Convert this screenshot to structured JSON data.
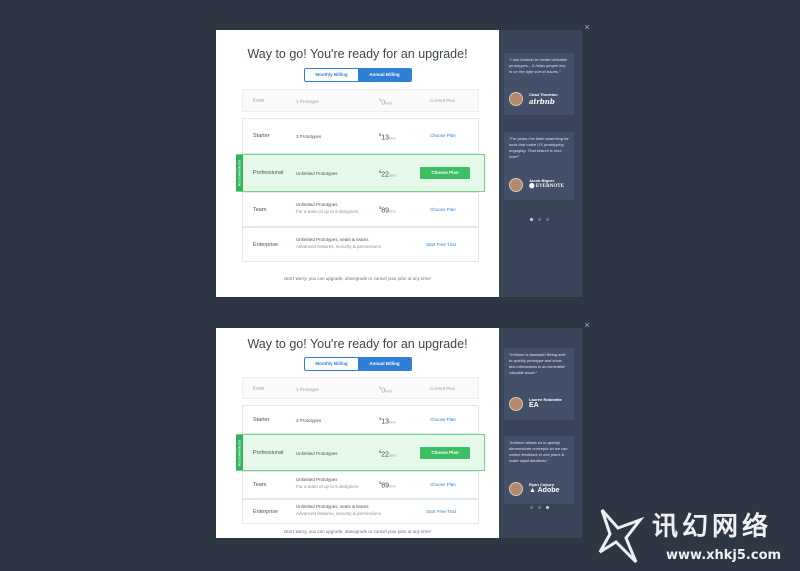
{
  "modals": [
    {
      "title": "Way to go! You're ready for an upgrade!",
      "billing": {
        "monthly": "Monthly Billing",
        "annual": "Annual Billing",
        "selected": "annual"
      },
      "plans": {
        "free": {
          "name": "Free",
          "desc": "1 Prototype",
          "price_symbol": "$",
          "price": "0",
          "per": "/mo",
          "action": "Current Plan"
        },
        "starter": {
          "name": "Starter",
          "desc": "3 Prototypes",
          "price_symbol": "$",
          "price": "13",
          "per": "/mo",
          "action": "Choose Plan"
        },
        "professional": {
          "name": "Professional",
          "desc": "Unlimited Prototypes",
          "price_symbol": "$",
          "price": "22",
          "per": "/mo",
          "action": "Choose Plan",
          "badge": "RECOMMENDED"
        },
        "team": {
          "name": "Team",
          "desc": "Unlimited Prototypes",
          "sub": "For a team of up to 5 designers",
          "price_symbol": "$",
          "price": "89",
          "per": "/mo",
          "action": "Choose Plan"
        },
        "enterprise": {
          "name": "Enterprise",
          "desc": "Unlimited Prototypes, seats & teams",
          "sub": "Advanced features, security & permissions",
          "action": "Start Free Trial"
        }
      },
      "footnote": "Don't worry, you can upgrade, downgrade or cancel your plan at any time!",
      "close": "×",
      "testimonials": [
        {
          "quote": "\"I use Invision to create clickable prototypes... It helps people key in on the right sort of issues.\"",
          "name": "Chad Thornton",
          "brand": "airbnb"
        },
        {
          "quote": "\"For years I've been searching for tools that make UX prototyping engaging. That search is now over!\"",
          "name": "Jacob Bigner",
          "brand": "EVERNOTE"
        }
      ]
    },
    {
      "title": "Way to go! You're ready for an upgrade!",
      "billing": {
        "monthly": "Monthly Billing",
        "annual": "Annual Billing",
        "selected": "annual"
      },
      "plans": {
        "free": {
          "name": "Free",
          "desc": "1 Prototype",
          "price_symbol": "$",
          "price": "0",
          "per": "/mo",
          "action": "Current Plan"
        },
        "starter": {
          "name": "Starter",
          "desc": "3 Prototypes",
          "price_symbol": "$",
          "price": "13",
          "per": "/mo",
          "action": "Choose Plan"
        },
        "professional": {
          "name": "Professional",
          "desc": "Unlimited Prototypes",
          "price_symbol": "$",
          "price": "22",
          "per": "/mo",
          "action": "Choose Plan",
          "badge": "RECOMMENDED"
        },
        "team": {
          "name": "Team",
          "desc": "Unlimited Prototypes",
          "sub": "For a team of up to 5 designers",
          "price_symbol": "$",
          "price": "89",
          "per": "/mo",
          "action": "Choose Plan"
        },
        "enterprise": {
          "name": "Enterprise",
          "desc": "Unlimited Prototypes, seats & teams",
          "sub": "Advanced features, security & permissions",
          "action": "Start Free Trial"
        }
      },
      "footnote": "Don't worry, you can upgrade, downgrade or cancel your plan at any time!",
      "close": "×",
      "testimonials": [
        {
          "quote": "\"InVision is fantastic! Being able to quickly prototype and show fast interactions is an incredible valuable asset.\"",
          "name": "Lauren Robinette",
          "brand": "EA"
        },
        {
          "quote": "\"InVision allows us to quickly demonstrate concepts so we can collect feedback in one place & make rapid iterations.\"",
          "name": "Ryan Coburn",
          "brand": "Adobe"
        }
      ]
    }
  ],
  "watermark": {
    "text_cn": "讯幻网络",
    "url": "www.xhkj5.com"
  }
}
